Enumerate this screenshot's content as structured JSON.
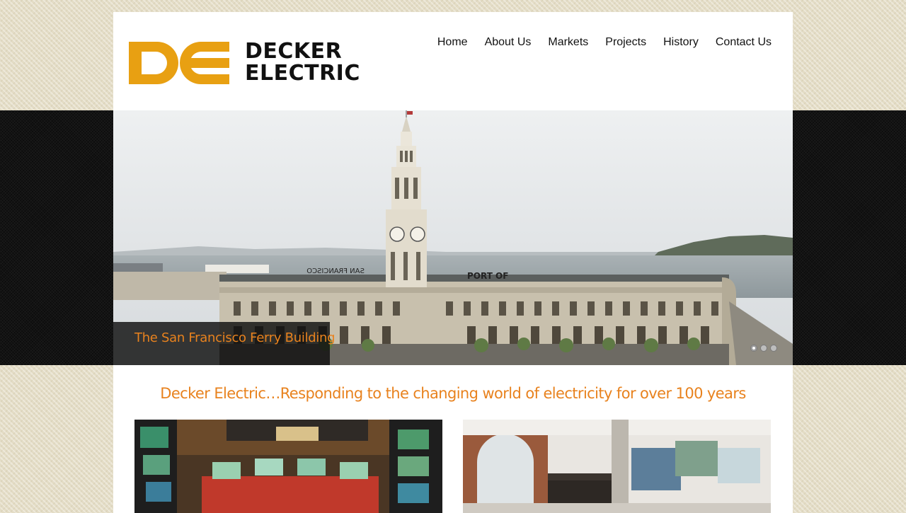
{
  "brand": {
    "line1": "DECKER",
    "line2": "ELECTRIC",
    "accent_color": "#e8a012"
  },
  "nav": {
    "items": [
      "Home",
      "About Us",
      "Markets",
      "Projects",
      "History",
      "Contact Us"
    ]
  },
  "slider": {
    "caption": "The San Francisco Ferry Building",
    "slide_count": 3,
    "active_slide": 1
  },
  "tagline": "Decker Electric…Responding to the changing world of electricity for over 100 years",
  "colors": {
    "accent_orange": "#e8821e",
    "logo_orange": "#e8a012"
  }
}
